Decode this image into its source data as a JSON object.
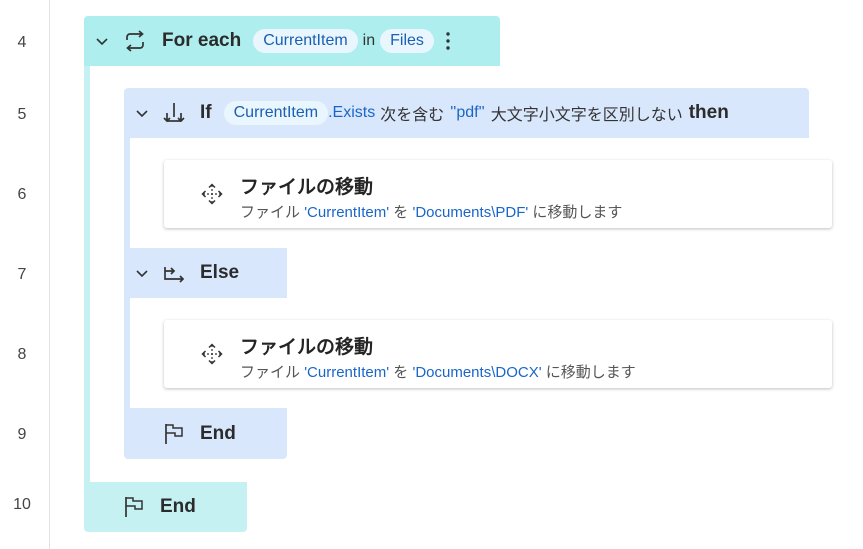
{
  "line_numbers": [
    "4",
    "5",
    "6",
    "7",
    "8",
    "9",
    "10"
  ],
  "loop": {
    "keyword": "For each",
    "variable": "CurrentItem",
    "in_text": "in",
    "collection": "Files",
    "more_icon": "more-vertical-icon",
    "end_label": "End"
  },
  "if_block": {
    "keyword": "If",
    "variable": "CurrentItem",
    "property": ".Exists",
    "op_text": "次を含む",
    "value": "''pdf''",
    "case_text": "大文字小文字を区別しない",
    "then_text": "then",
    "else_label": "Else",
    "end_label": "End"
  },
  "actions": [
    {
      "title": "ファイルの移動",
      "prefix": "ファイル",
      "file_var": "'CurrentItem'",
      "mid": "を",
      "dest": "'Documents\\PDF'",
      "suffix": "に移動します"
    },
    {
      "title": "ファイルの移動",
      "prefix": "ファイル",
      "file_var": "'CurrentItem'",
      "mid": "を",
      "dest": "'Documents\\DOCX'",
      "suffix": "に移動します"
    }
  ],
  "colors": {
    "loop_head": "#aeeeee",
    "loop_body": "#c5f1f2",
    "if_body": "#d9e7fc",
    "variable_blue": "#1a66c8"
  }
}
